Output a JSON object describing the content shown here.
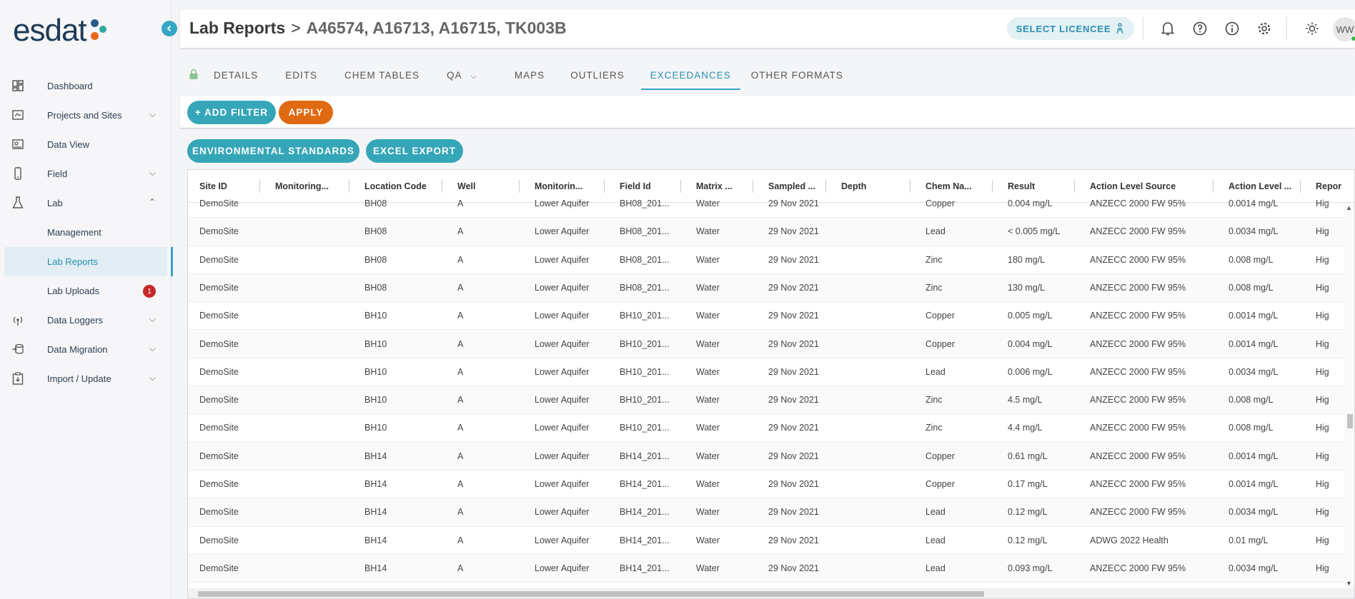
{
  "app": {
    "logo_text": "esdat",
    "header_title": "Lab Reports",
    "header_separator": ">",
    "header_subtitle": "A46574, A16713, A16715, TK003B",
    "select_licencee_label": "SELECT LICENCEE",
    "avatar_initials": "WW"
  },
  "sidebar": {
    "items": [
      {
        "label": "Dashboard",
        "icon": "dashboard-icon",
        "expandable": false
      },
      {
        "label": "Projects and Sites",
        "icon": "projects-icon",
        "expandable": true
      },
      {
        "label": "Data View",
        "icon": "data-view-icon",
        "expandable": false
      },
      {
        "label": "Field",
        "icon": "phone-icon",
        "expandable": true
      },
      {
        "label": "Lab",
        "icon": "flask-icon",
        "expandable": true,
        "expanded": true
      },
      {
        "label": "Management",
        "icon": "",
        "expandable": false
      },
      {
        "label": "Lab Reports",
        "icon": "",
        "expandable": false,
        "active": true
      },
      {
        "label": "Lab Uploads",
        "icon": "",
        "expandable": false,
        "badge": "1"
      },
      {
        "label": "Data Loggers",
        "icon": "signal-icon",
        "expandable": true
      },
      {
        "label": "Data Migration",
        "icon": "migration-icon",
        "expandable": true
      },
      {
        "label": "Import / Update",
        "icon": "import-icon",
        "expandable": true
      }
    ]
  },
  "tabs": [
    {
      "label": "DETAILS"
    },
    {
      "label": "EDITS"
    },
    {
      "label": "CHEM TABLES"
    },
    {
      "label": "QA"
    },
    {
      "label": "MAPS"
    },
    {
      "label": "OUTLIERS"
    },
    {
      "label": "EXCEEDANCES",
      "active": true
    },
    {
      "label": "OTHER FORMATS"
    }
  ],
  "filter": {
    "add_filter_label": "+ ADD FILTER",
    "apply_label": "APPLY",
    "env_standards_label": "ENVIRONMENTAL STANDARDS",
    "excel_export_label": "EXCEL EXPORT"
  },
  "table": {
    "columns": [
      "Site ID",
      "Monitoring...",
      "Location Code",
      "Well",
      "Monitorin...",
      "Field Id",
      "Matrix ...",
      "Sampled ...",
      "Depth",
      "Chem Na...",
      "Result",
      "Action Level Source",
      "Action Level ...",
      "Repor"
    ],
    "rows": [
      [
        "DemoSite",
        "",
        "BH08",
        "A",
        "Lower Aquifer",
        "BH08_201...",
        "Water",
        "29 Nov 2021",
        "",
        "Copper",
        "0.004 mg/L",
        "ANZECC 2000 FW 95%",
        "0.0014 mg/L",
        "Hig"
      ],
      [
        "DemoSite",
        "",
        "BH08",
        "A",
        "Lower Aquifer",
        "BH08_201...",
        "Water",
        "29 Nov 2021",
        "",
        "Lead",
        "< 0.005 mg/L",
        "ANZECC 2000 FW 95%",
        "0.0034 mg/L",
        "Hig"
      ],
      [
        "DemoSite",
        "",
        "BH08",
        "A",
        "Lower Aquifer",
        "BH08_201...",
        "Water",
        "29 Nov 2021",
        "",
        "Zinc",
        "180 mg/L",
        "ANZECC 2000 FW 95%",
        "0.008 mg/L",
        "Hig"
      ],
      [
        "DemoSite",
        "",
        "BH08",
        "A",
        "Lower Aquifer",
        "BH08_201...",
        "Water",
        "29 Nov 2021",
        "",
        "Zinc",
        "130 mg/L",
        "ANZECC 2000 FW 95%",
        "0.008 mg/L",
        "Hig"
      ],
      [
        "DemoSite",
        "",
        "BH10",
        "A",
        "Lower Aquifer",
        "BH10_201...",
        "Water",
        "29 Nov 2021",
        "",
        "Copper",
        "0.005 mg/L",
        "ANZECC 2000 FW 95%",
        "0.0014 mg/L",
        "Hig"
      ],
      [
        "DemoSite",
        "",
        "BH10",
        "A",
        "Lower Aquifer",
        "BH10_201...",
        "Water",
        "29 Nov 2021",
        "",
        "Copper",
        "0.004 mg/L",
        "ANZECC 2000 FW 95%",
        "0.0014 mg/L",
        "Hig"
      ],
      [
        "DemoSite",
        "",
        "BH10",
        "A",
        "Lower Aquifer",
        "BH10_201...",
        "Water",
        "29 Nov 2021",
        "",
        "Lead",
        "0.006 mg/L",
        "ANZECC 2000 FW 95%",
        "0.0034 mg/L",
        "Hig"
      ],
      [
        "DemoSite",
        "",
        "BH10",
        "A",
        "Lower Aquifer",
        "BH10_201...",
        "Water",
        "29 Nov 2021",
        "",
        "Zinc",
        "4.5 mg/L",
        "ANZECC 2000 FW 95%",
        "0.008 mg/L",
        "Hig"
      ],
      [
        "DemoSite",
        "",
        "BH10",
        "A",
        "Lower Aquifer",
        "BH10_201...",
        "Water",
        "29 Nov 2021",
        "",
        "Zinc",
        "4.4 mg/L",
        "ANZECC 2000 FW 95%",
        "0.008 mg/L",
        "Hig"
      ],
      [
        "DemoSite",
        "",
        "BH14",
        "A",
        "Lower Aquifer",
        "BH14_201...",
        "Water",
        "29 Nov 2021",
        "",
        "Copper",
        "0.61 mg/L",
        "ANZECC 2000 FW 95%",
        "0.0014 mg/L",
        "Hig"
      ],
      [
        "DemoSite",
        "",
        "BH14",
        "A",
        "Lower Aquifer",
        "BH14_201...",
        "Water",
        "29 Nov 2021",
        "",
        "Copper",
        "0.17 mg/L",
        "ANZECC 2000 FW 95%",
        "0.0014 mg/L",
        "Hig"
      ],
      [
        "DemoSite",
        "",
        "BH14",
        "A",
        "Lower Aquifer",
        "BH14_201...",
        "Water",
        "29 Nov 2021",
        "",
        "Lead",
        "0.12 mg/L",
        "ANZECC 2000 FW 95%",
        "0.0034 mg/L",
        "Hig"
      ],
      [
        "DemoSite",
        "",
        "BH14",
        "A",
        "Lower Aquifer",
        "BH14_201...",
        "Water",
        "29 Nov 2021",
        "",
        "Lead",
        "0.12 mg/L",
        "ADWG 2022 Health",
        "0.01 mg/L",
        "Hig"
      ],
      [
        "DemoSite",
        "",
        "BH14",
        "A",
        "Lower Aquifer",
        "BH14_201...",
        "Water",
        "29 Nov 2021",
        "",
        "Lead",
        "0.093 mg/L",
        "ANZECC 2000 FW 95%",
        "0.0034 mg/L",
        "Hig"
      ]
    ]
  },
  "colors": {
    "accent": "#35a6c4",
    "apply": "#e06a12",
    "badge": "#c62828"
  }
}
